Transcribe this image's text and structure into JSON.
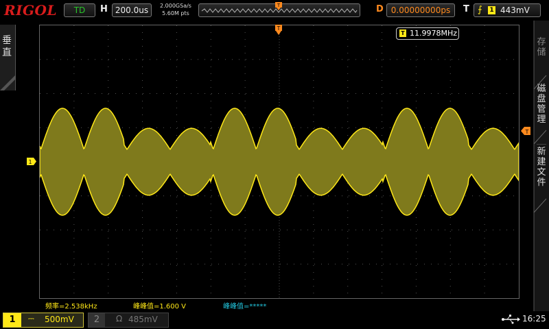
{
  "topbar": {
    "brand": "RIGOL",
    "run_state": "TD",
    "horizontal_label": "H",
    "timebase": "200.0us",
    "sample_rate": "2.000GSa/s",
    "memory_depth": "5.60M pts",
    "delay_label": "D",
    "delay_value": "0.00000000ps",
    "trigger_label": "T",
    "trigger_source": "1",
    "trigger_level": "443mV"
  },
  "left_tab": {
    "label": "垂直"
  },
  "right_menu": {
    "items": [
      {
        "label": "存储",
        "enabled": false
      },
      {
        "label": "磁盘管理",
        "enabled": true
      },
      {
        "label": "新建文件",
        "enabled": true
      }
    ]
  },
  "grid": {
    "frequency_counter": {
      "channel": "T",
      "value": "11.9978MHz"
    },
    "trigger_marker": "T",
    "ch1_marker": "1"
  },
  "measurements": [
    {
      "text": "频率=2.538kHz"
    },
    {
      "text": "峰峰值=1.600  V"
    },
    {
      "text": "峰峰值=*****"
    }
  ],
  "channels": [
    {
      "num": "1",
      "coupling": "⎓",
      "scale": "500mV",
      "active": true
    },
    {
      "num": "2",
      "coupling": "Ω",
      "scale": "485mV",
      "active": false
    }
  ],
  "status": {
    "time": "16:25",
    "usb_icon": "usb-icon"
  },
  "colors": {
    "ch1": "#ffe817",
    "trace_fill": "#7f7a1c",
    "grid_dots": "#555",
    "delay": "#ff8a1e",
    "math": "#22c8e0"
  }
}
